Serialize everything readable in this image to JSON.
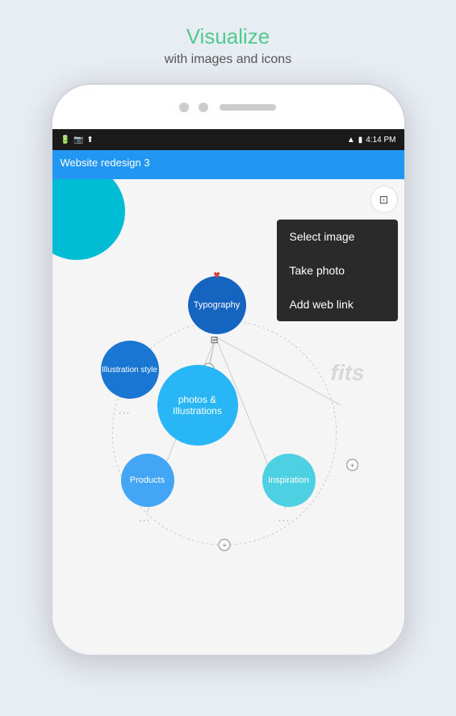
{
  "page": {
    "background_color": "#e8ecf3"
  },
  "header": {
    "title": "Visualize",
    "subtitle": "with images and icons",
    "title_color": "#4ecb8d"
  },
  "status_bar": {
    "time": "4:14 PM",
    "icons": [
      "battery",
      "wifi",
      "signal"
    ]
  },
  "app": {
    "title": "Website redesign 3"
  },
  "context_menu": {
    "items": [
      {
        "label": "Select image",
        "id": "select-image"
      },
      {
        "label": "Take photo",
        "id": "take-photo"
      },
      {
        "label": "Add web link",
        "id": "add-web-link"
      }
    ]
  },
  "nodes": [
    {
      "id": "typography",
      "label": "Typography",
      "color": "#1565c0"
    },
    {
      "id": "illustration-style",
      "label": "Illustration style",
      "color": "#1976d2"
    },
    {
      "id": "photos-illustrations",
      "label": "photos & Illustrations",
      "color": "#29b6f6"
    },
    {
      "id": "products",
      "label": "Products",
      "color": "#42a5f5"
    },
    {
      "id": "inspiration",
      "label": "Inspiration",
      "color": "#4dd0e1"
    }
  ],
  "watermark": {
    "text": "fits"
  },
  "icons": {
    "heart": "♥",
    "delete": "🗑",
    "plus": "+",
    "screen_icon": "▣"
  }
}
